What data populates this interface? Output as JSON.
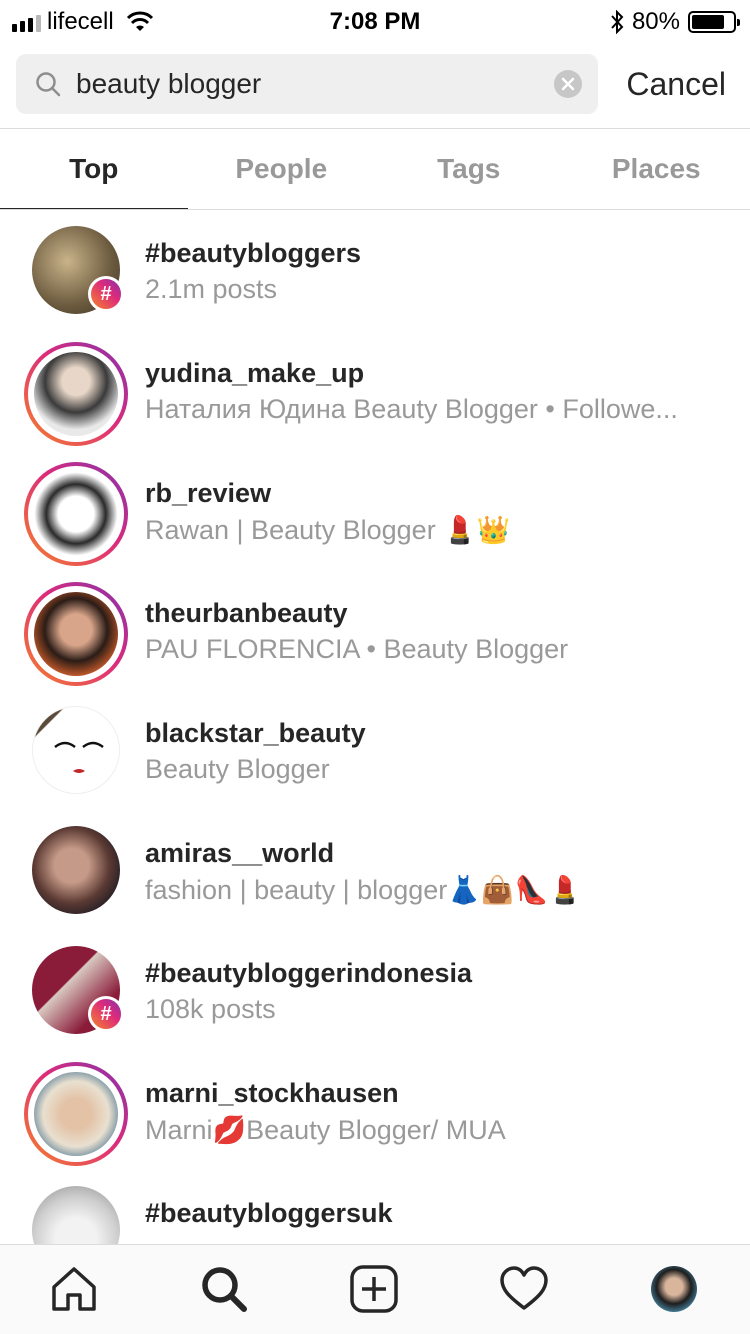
{
  "status_bar": {
    "carrier": "lifecell",
    "time": "7:08 PM",
    "battery": "80%",
    "battery_level": 0.8
  },
  "search": {
    "query": "beauty blogger",
    "cancel_label": "Cancel"
  },
  "tabs": [
    {
      "label": "Top",
      "active": true
    },
    {
      "label": "People",
      "active": false
    },
    {
      "label": "Tags",
      "active": false
    },
    {
      "label": "Places",
      "active": false
    }
  ],
  "results": [
    {
      "title": "#beautybloggers",
      "subtitle": "2.1m posts"
    },
    {
      "title": "yudina_make_up",
      "subtitle": "Наталия Юдина Beauty Blogger • Followe..."
    },
    {
      "title": "rb_review",
      "subtitle": "Rawan | Beauty Blogger 💄👑"
    },
    {
      "title": "theurbanbeauty",
      "subtitle": "PAU FLORENCIA • Beauty Blogger"
    },
    {
      "title": "blackstar_beauty",
      "subtitle": "Beauty Blogger"
    },
    {
      "title": "amiras__world",
      "subtitle": "fashion | beauty | blogger👗👜👠💄"
    },
    {
      "title": "#beautybloggerindonesia",
      "subtitle": "108k posts"
    },
    {
      "title": "marni_stockhausen",
      "subtitle": "Marni💋Beauty Blogger/ MUA"
    },
    {
      "title": "#beautybloggersuk",
      "subtitle": ""
    }
  ],
  "badges": {
    "hashtag": "#"
  },
  "icons": {
    "search": "search-icon",
    "clear": "clear-icon",
    "home": "home-icon",
    "explore": "search-icon",
    "new_post": "plus-square-icon",
    "activity": "heart-icon",
    "profile": "profile-avatar"
  },
  "colors": {
    "text_primary": "#262626",
    "text_secondary": "#999999",
    "divider": "#dbdbdb",
    "search_bg": "#efefef",
    "story_ring_start": "#f58529",
    "story_ring_end": "#8134af"
  }
}
